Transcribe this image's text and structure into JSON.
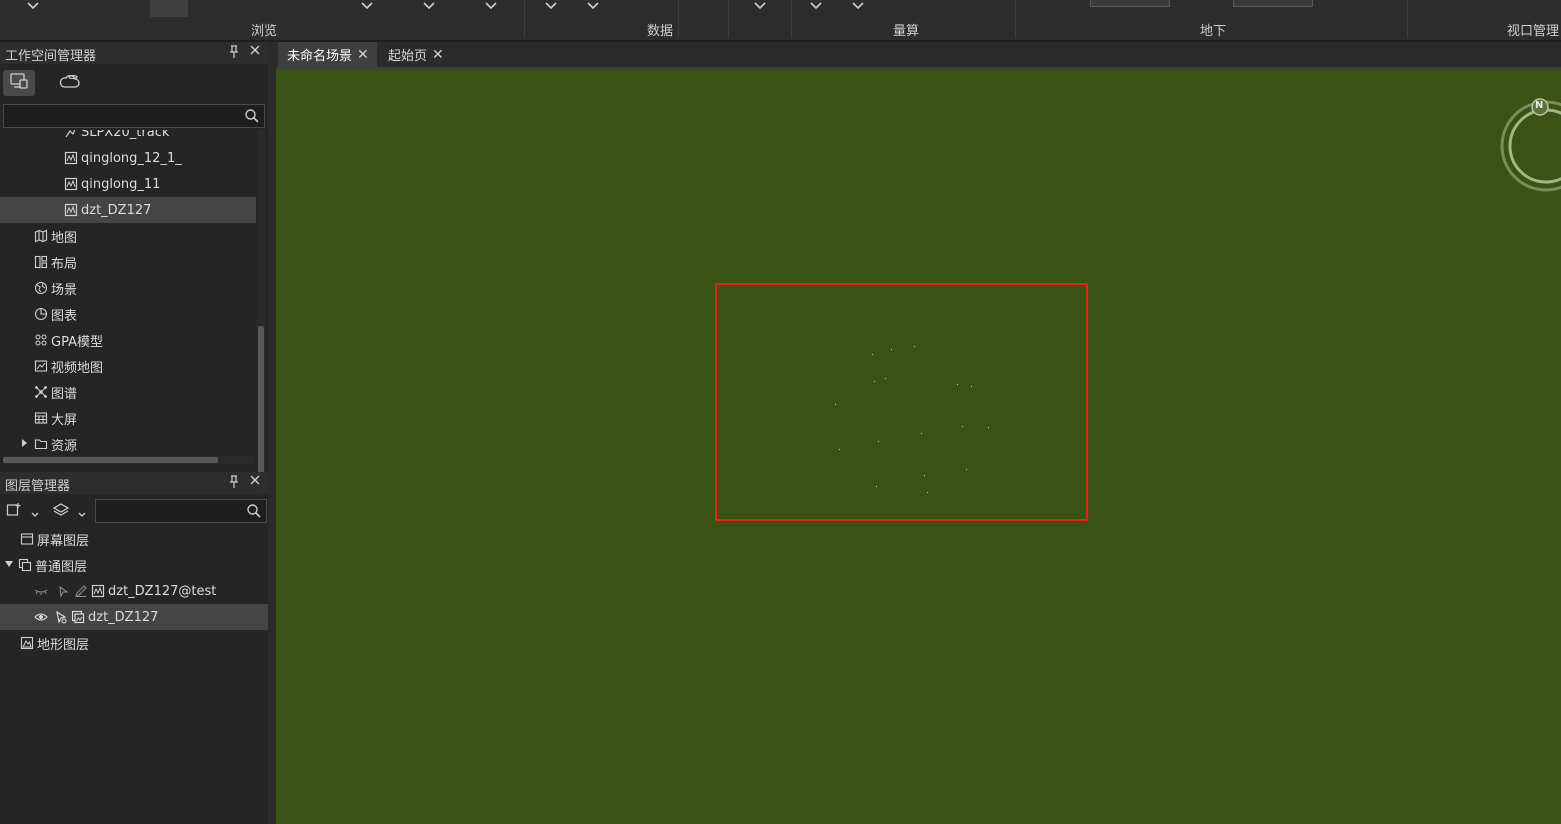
{
  "ribbon": {
    "groups": [
      {
        "label": "浏览"
      },
      {
        "label": "数据"
      },
      {
        "label": "量算"
      },
      {
        "label": "地下"
      },
      {
        "label": "视口管理"
      }
    ]
  },
  "workspace_panel": {
    "title": "工作空间管理器",
    "tree": [
      {
        "label": "SLPX20_track",
        "icon": "line-dataset-icon"
      },
      {
        "label": "qinglong_12_1_",
        "icon": "dataset-icon"
      },
      {
        "label": "qinglong_11",
        "icon": "dataset-icon"
      },
      {
        "label": "dzt_DZ127",
        "icon": "dataset-icon",
        "selected": true
      },
      {
        "label": "地图",
        "icon": "map-icon"
      },
      {
        "label": "布局",
        "icon": "layout-icon"
      },
      {
        "label": "场景",
        "icon": "globe-icon"
      },
      {
        "label": "图表",
        "icon": "chart-icon"
      },
      {
        "label": "GPA模型",
        "icon": "gpa-model-icon"
      },
      {
        "label": "视频地图",
        "icon": "video-map-icon"
      },
      {
        "label": "图谱",
        "icon": "graph-icon"
      },
      {
        "label": "大屏",
        "icon": "big-screen-icon"
      },
      {
        "label": "资源",
        "icon": "folder-icon"
      }
    ]
  },
  "layer_panel": {
    "title": "图层管理器",
    "items": [
      {
        "label": "屏幕图层",
        "icon": "screen-layer-icon"
      },
      {
        "label": "普通图层",
        "icon": "normal-layer-icon"
      },
      {
        "label": "dzt_DZ127@test",
        "icon": "dataset-icon"
      },
      {
        "label": "dzt_DZ127",
        "icon": "image-layer-icon",
        "selected": true
      },
      {
        "label": "地形图层",
        "icon": "terrain-layer-icon"
      }
    ]
  },
  "doc_tabs": [
    {
      "label": "未命名场景",
      "active": true
    },
    {
      "label": "起始页",
      "active": false
    }
  ],
  "compass": {
    "label": "N"
  },
  "colors": {
    "scene_bg": "#3a5213",
    "highlight": "#e8221a",
    "panel_bg": "#252526"
  }
}
